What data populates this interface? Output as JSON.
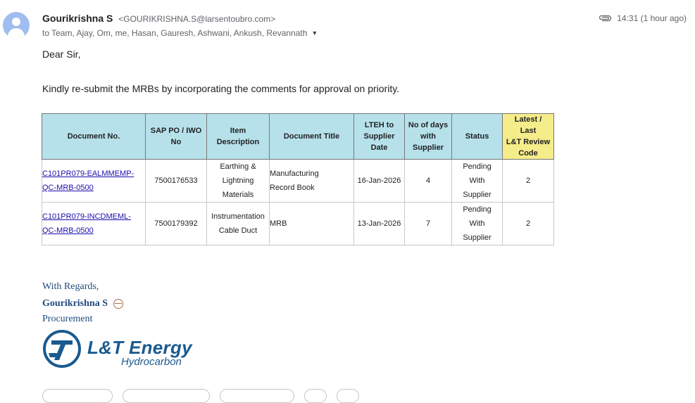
{
  "header": {
    "sender_name": "Gourikrishna S",
    "sender_email": "<GOURIKRISHNA.S@larsentoubro.com>",
    "to_line": "to Team, Ajay, Om, me, Hasan, Gauresh, Ashwani, Ankush, Revannath",
    "time": "14:31 (1 hour ago)",
    "attachment_icon": "paperclip-icon"
  },
  "body": {
    "greeting": "Dear Sir,",
    "message": "Kindly re-submit the MRBs by incorporating the comments for approval on priority."
  },
  "table": {
    "headers": {
      "doc_no": "Document No.",
      "sap_po_1": "SAP PO / IWO",
      "sap_po_2": "No",
      "item_1": "Item",
      "item_2": "Description",
      "title": "Document Title",
      "lteh_1": "LTEH to",
      "lteh_2": "Supplier",
      "lteh_3": "Date",
      "days_1": "No of days",
      "days_2": "with",
      "days_3": "Supplier",
      "status": "Status",
      "code_1": "Latest /",
      "code_2": "Last",
      "code_3": "L&T Review",
      "code_4": "Code"
    },
    "rows": [
      {
        "doc_no_1": "C101PR079-EALMMEMP-",
        "doc_no_2": "QC-MRB-0500",
        "sap_po": "7500176533",
        "item_1": "Earthing &",
        "item_2": "Lightning",
        "item_3": "Materials",
        "title_1": "Manufacturing",
        "title_2": "Record Book",
        "date": "16-Jan-2026",
        "days": "4",
        "status_1": "Pending",
        "status_2": "With",
        "status_3": "Supplier",
        "code": "2"
      },
      {
        "doc_no_1": "C101PR079-INCDMEML-",
        "doc_no_2": "QC-MRB-0500",
        "sap_po": "7500179392",
        "item_1": "Instrumentation",
        "item_2": "Cable Duct",
        "title_1": "MRB",
        "date": "13-Jan-2026",
        "days": "7",
        "status_1": "Pending",
        "status_2": "With",
        "status_3": "Supplier",
        "code": "2"
      }
    ]
  },
  "signature": {
    "regards": "With Regards,",
    "name": "Gourikrishna S",
    "role": "Procurement",
    "logo_title": "L&T Energy",
    "logo_subtitle": "Hydrocarbon"
  },
  "colors": {
    "header_cell": "#b7e1ea",
    "code_header_cell": "#f5ec8a",
    "signature_text": "#1f497d",
    "logo_blue": "#1a5a8f",
    "link": "#1a0dab"
  }
}
